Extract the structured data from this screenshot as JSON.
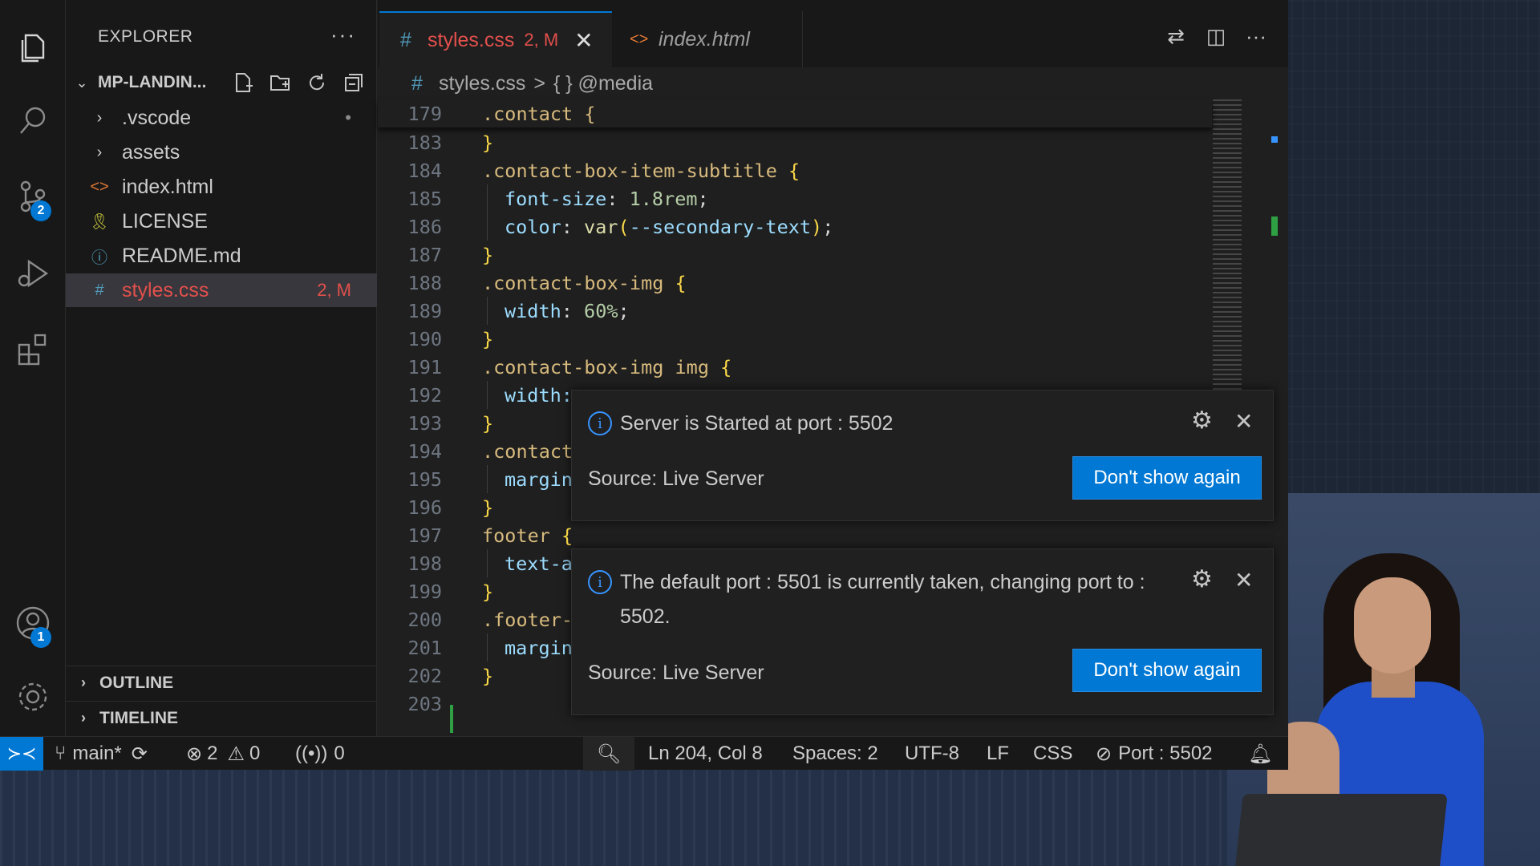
{
  "explorer": {
    "title": "EXPLORER",
    "more": "···",
    "folder": "MP-LANDIN...",
    "items": [
      {
        "icon": "chevron-right",
        "glyph": "›",
        "label": ".vscode",
        "status": "•",
        "color": "#cccccc"
      },
      {
        "icon": "chevron-right",
        "glyph": "›",
        "label": "assets",
        "status": "",
        "color": "#cccccc"
      },
      {
        "icon": "html-icon",
        "glyph": "<>",
        "label": "index.html",
        "status": "",
        "color": "#cccccc"
      },
      {
        "icon": "license-icon",
        "glyph": "🎗",
        "label": "LICENSE",
        "status": "",
        "color": "#cccccc"
      },
      {
        "icon": "info-icon",
        "glyph": "ⓘ",
        "label": "README.md",
        "status": "",
        "color": "#cccccc"
      },
      {
        "icon": "css-icon",
        "glyph": "#",
        "label": "styles.css",
        "status": "2, M",
        "color": "#e2504c"
      }
    ],
    "sections": [
      "OUTLINE",
      "TIMELINE"
    ]
  },
  "activity_badges": {
    "source_control": "2",
    "accounts": "1"
  },
  "tabs": [
    {
      "icon": "#",
      "label": "styles.css",
      "status": "2, M",
      "active": true
    },
    {
      "icon": "<>",
      "label": "index.html",
      "active": false
    }
  ],
  "breadcrumb": {
    "icon": "#",
    "file": "styles.css",
    "sep": ">",
    "symbol": "{ } @media"
  },
  "sticky_line": {
    "number": "179",
    "text": ".contact {"
  },
  "code_lines": [
    {
      "n": "183",
      "indent": 0,
      "parts": [
        {
          "t": "}",
          "c": "br"
        }
      ]
    },
    {
      "n": "184",
      "indent": 0,
      "parts": [
        {
          "t": ".contact-box-item-subtitle ",
          "c": "sel"
        },
        {
          "t": "{",
          "c": "br"
        }
      ]
    },
    {
      "n": "185",
      "indent": 1,
      "parts": [
        {
          "t": "font-size",
          "c": "prop"
        },
        {
          "t": ": ",
          "c": "plain"
        },
        {
          "t": "1.8rem",
          "c": "num"
        },
        {
          "t": ";",
          "c": "plain"
        }
      ]
    },
    {
      "n": "186",
      "indent": 1,
      "parts": [
        {
          "t": "color",
          "c": "prop"
        },
        {
          "t": ": ",
          "c": "plain"
        },
        {
          "t": "var",
          "c": "fn"
        },
        {
          "t": "(",
          "c": "br"
        },
        {
          "t": "--secondary-text",
          "c": "prop"
        },
        {
          "t": ")",
          "c": "br"
        },
        {
          "t": ";",
          "c": "plain"
        }
      ]
    },
    {
      "n": "187",
      "indent": 0,
      "parts": [
        {
          "t": "}",
          "c": "br"
        }
      ]
    },
    {
      "n": "188",
      "indent": 0,
      "parts": [
        {
          "t": ".contact-box-img ",
          "c": "sel"
        },
        {
          "t": "{",
          "c": "br"
        }
      ]
    },
    {
      "n": "189",
      "indent": 1,
      "parts": [
        {
          "t": "width",
          "c": "prop"
        },
        {
          "t": ": ",
          "c": "plain"
        },
        {
          "t": "60%",
          "c": "num"
        },
        {
          "t": ";",
          "c": "plain"
        }
      ]
    },
    {
      "n": "190",
      "indent": 0,
      "parts": [
        {
          "t": "}",
          "c": "br"
        }
      ]
    },
    {
      "n": "191",
      "indent": 0,
      "parts": [
        {
          "t": ".contact-box-img img ",
          "c": "sel"
        },
        {
          "t": "{",
          "c": "br"
        }
      ]
    },
    {
      "n": "192",
      "indent": 1,
      "parts": [
        {
          "t": "width:",
          "c": "prop"
        }
      ]
    },
    {
      "n": "193",
      "indent": 0,
      "parts": [
        {
          "t": "}",
          "c": "br"
        }
      ]
    },
    {
      "n": "194",
      "indent": 0,
      "parts": [
        {
          "t": ".contact",
          "c": "sel"
        }
      ]
    },
    {
      "n": "195",
      "indent": 1,
      "parts": [
        {
          "t": "margin",
          "c": "prop"
        }
      ]
    },
    {
      "n": "196",
      "indent": 0,
      "parts": [
        {
          "t": "}",
          "c": "br"
        }
      ]
    },
    {
      "n": "197",
      "indent": 0,
      "parts": [
        {
          "t": "footer ",
          "c": "sel"
        },
        {
          "t": "{",
          "c": "br"
        }
      ]
    },
    {
      "n": "198",
      "indent": 1,
      "parts": [
        {
          "t": "text-a",
          "c": "prop"
        }
      ]
    },
    {
      "n": "199",
      "indent": 0,
      "parts": [
        {
          "t": "}",
          "c": "br"
        }
      ]
    },
    {
      "n": "200",
      "indent": 0,
      "parts": [
        {
          "t": ".footer-",
          "c": "sel"
        }
      ]
    },
    {
      "n": "201",
      "indent": 1,
      "parts": [
        {
          "t": "margin",
          "c": "prop"
        }
      ]
    },
    {
      "n": "202",
      "indent": 0,
      "parts": [
        {
          "t": "}",
          "c": "br"
        }
      ]
    },
    {
      "n": "203",
      "indent": 0,
      "parts": []
    }
  ],
  "notifications": [
    {
      "message": "Server is Started at port : 5502",
      "source": "Source: Live Server",
      "button": "Don't show again"
    },
    {
      "message": "The default port : 5501 is currently taken, changing port to : 5502.",
      "source": "Source: Live Server",
      "button": "Don't show again"
    }
  ],
  "statusbar": {
    "branch": "main*",
    "errors": "2",
    "warnings": "0",
    "ports": "0",
    "position": "Ln 204, Col 8",
    "spaces": "Spaces: 2",
    "encoding": "UTF-8",
    "eol": "LF",
    "language": "CSS",
    "live_server": "Port : 5502"
  },
  "colors": {
    "accent": "#0078d4",
    "modified": "#e2504c",
    "info": "#3794ff"
  }
}
